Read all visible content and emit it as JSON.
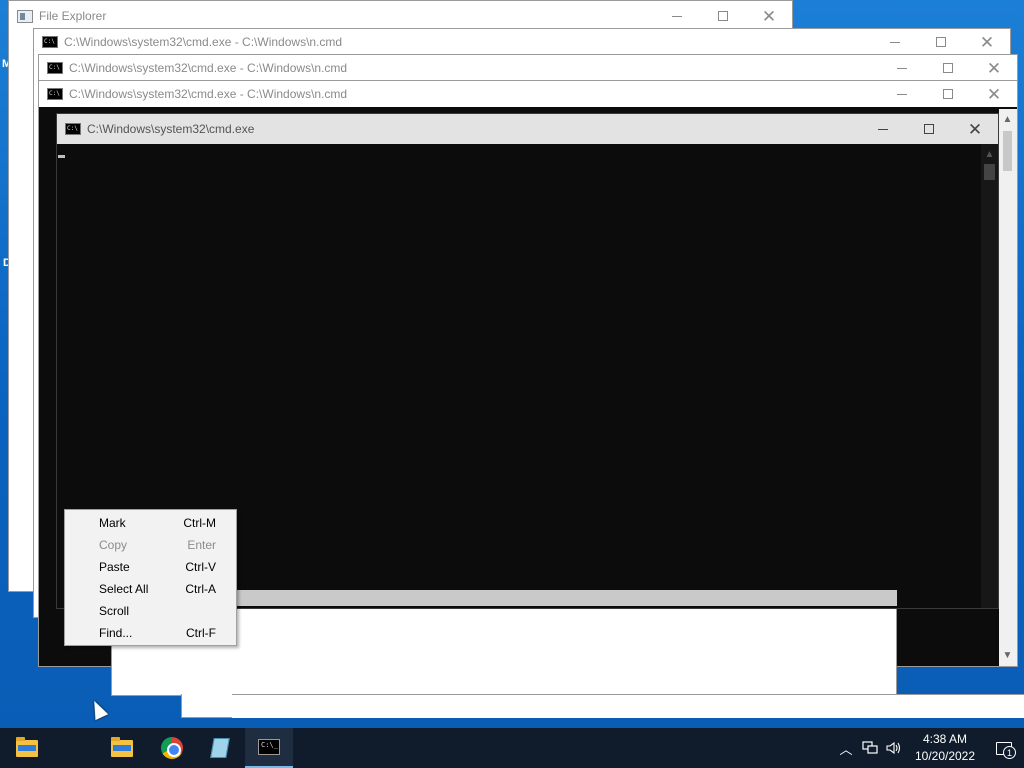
{
  "desktop": {
    "edge_letter_1": "M",
    "edge_letter_2": "D"
  },
  "windows": {
    "file_explorer": {
      "title": "File Explorer"
    },
    "cmd_back_1": {
      "title": "C:\\Windows\\system32\\cmd.exe - C:\\Windows\\n.cmd"
    },
    "cmd_back_2": {
      "title": "C:\\Windows\\system32\\cmd.exe - C:\\Windows\\n.cmd"
    },
    "cmd_back_3": {
      "title": "C:\\Windows\\system32\\cmd.exe - C:\\Windows\\n.cmd"
    },
    "cmd_active": {
      "title": "C:\\Windows\\system32\\cmd.exe"
    }
  },
  "context_menu": {
    "items": [
      {
        "label": "Mark",
        "shortcut": "Ctrl-M",
        "enabled": true
      },
      {
        "label": "Copy",
        "shortcut": "Enter",
        "enabled": false
      },
      {
        "label": "Paste",
        "shortcut": "Ctrl-V",
        "enabled": true
      },
      {
        "label": "Select All",
        "shortcut": "Ctrl-A",
        "enabled": true
      },
      {
        "label": "Scroll",
        "shortcut": "",
        "enabled": true
      },
      {
        "label": "Find...",
        "shortcut": "Ctrl-F",
        "enabled": true
      }
    ]
  },
  "taskbar": {
    "pinned": [
      {
        "name": "File Explorer",
        "icon": "folder-icon"
      },
      {
        "name": "File Explorer",
        "icon": "folder-icon"
      },
      {
        "name": "Google Chrome",
        "icon": "chrome-icon"
      },
      {
        "name": "Notepad",
        "icon": "notepad-icon"
      },
      {
        "name": "Command Prompt",
        "icon": "cmd-icon",
        "active": true
      }
    ],
    "clock": {
      "time": "4:38 AM",
      "date": "10/20/2022"
    },
    "notifications_count": "1"
  },
  "colors": {
    "desktop": "#0a63bf",
    "console_bg": "#0c0c0c",
    "taskbar": "#101c2c",
    "active_indicator": "#76b9ed"
  }
}
